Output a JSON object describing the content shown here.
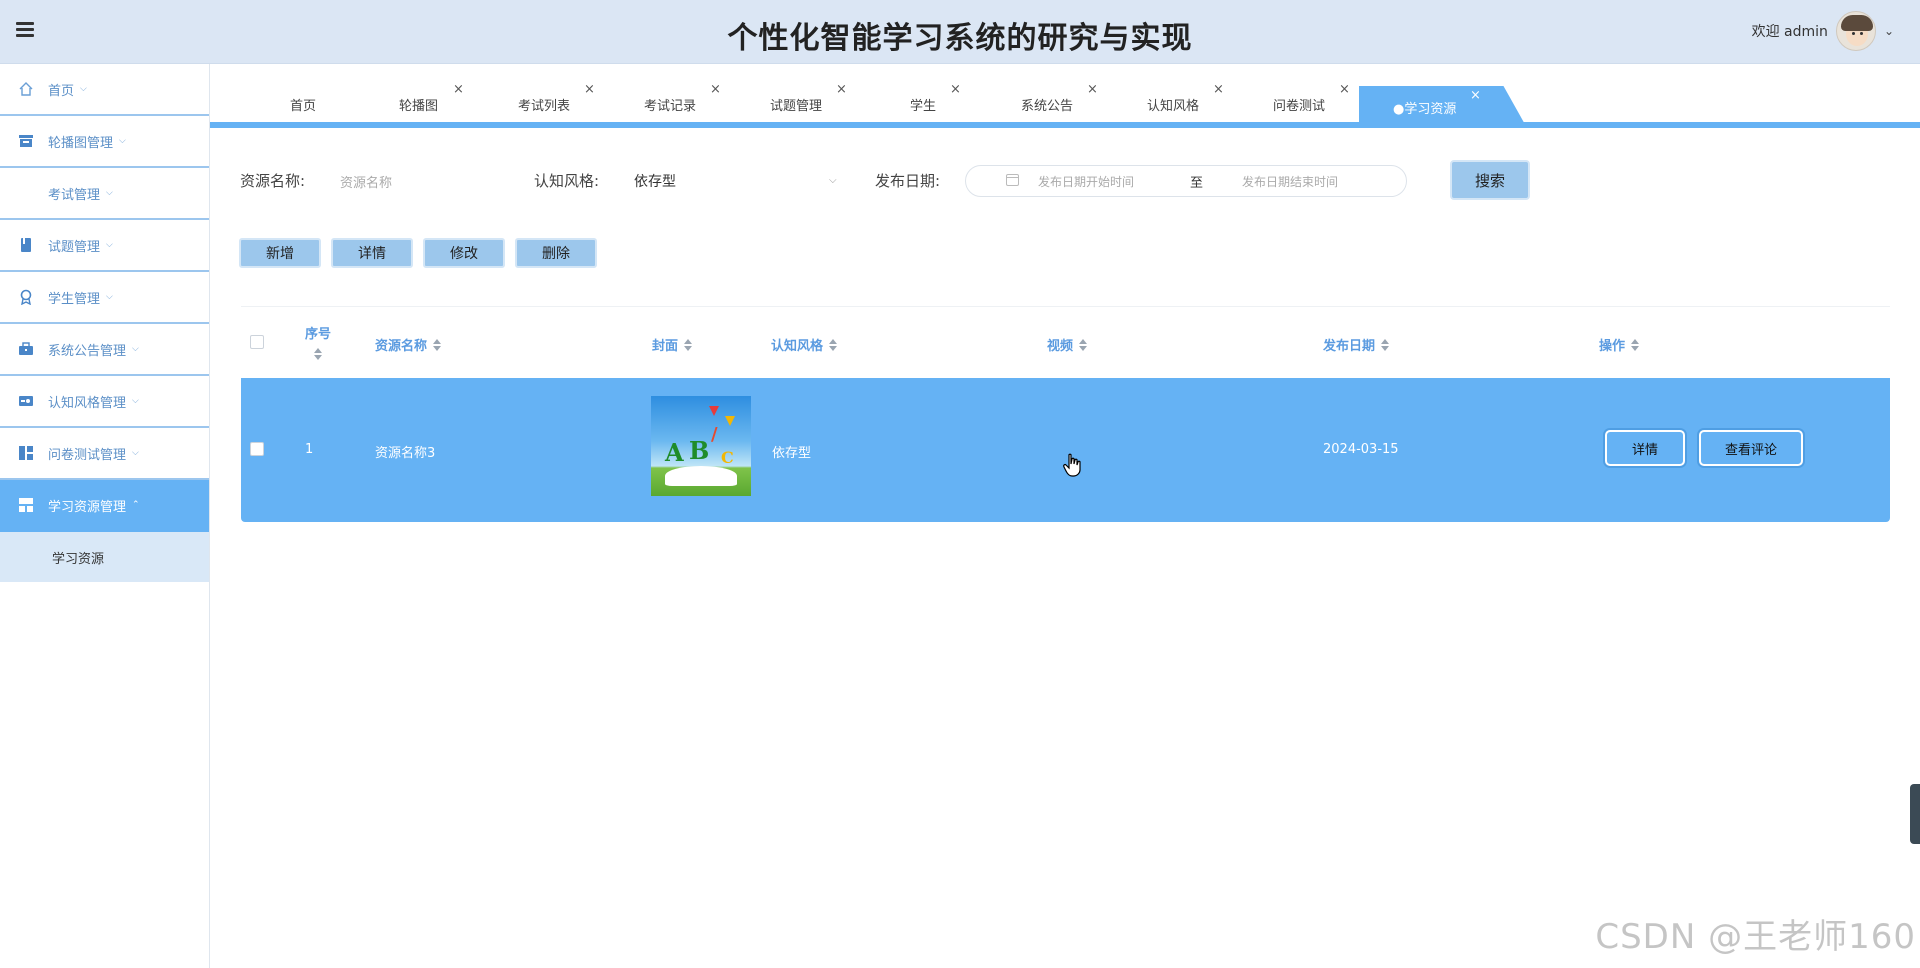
{
  "header": {
    "title": "个性化智能学习系统的研究与实现",
    "welcome": "欢迎 admin"
  },
  "sidebar": {
    "items": [
      {
        "label": "首页",
        "icon": "home-icon"
      },
      {
        "label": "轮播图管理",
        "icon": "carousel-icon"
      },
      {
        "label": "考试管理",
        "icon": ""
      },
      {
        "label": "试题管理",
        "icon": "book-icon"
      },
      {
        "label": "学生管理",
        "icon": "student-icon"
      },
      {
        "label": "系统公告管理",
        "icon": "briefcase-icon"
      },
      {
        "label": "认知风格管理",
        "icon": "style-icon"
      },
      {
        "label": "问卷测试管理",
        "icon": "grid-icon"
      },
      {
        "label": "学习资源管理",
        "icon": "layout-icon"
      }
    ],
    "sub_item": "学习资源"
  },
  "tabs": [
    {
      "label": "首页"
    },
    {
      "label": "轮播图"
    },
    {
      "label": "考试列表"
    },
    {
      "label": "考试记录"
    },
    {
      "label": "试题管理"
    },
    {
      "label": "学生"
    },
    {
      "label": "系统公告"
    },
    {
      "label": "认知风格"
    },
    {
      "label": "问卷测试"
    },
    {
      "label": "●学习资源"
    }
  ],
  "filters": {
    "name_label": "资源名称:",
    "name_placeholder": "资源名称",
    "style_label": "认知风格:",
    "style_value": "依存型",
    "date_label": "发布日期:",
    "date_start_placeholder": "发布日期开始时间",
    "date_sep": "至",
    "date_end_placeholder": "发布日期结束时间",
    "search_button": "搜索"
  },
  "actions": {
    "add": "新增",
    "detail": "详情",
    "edit": "修改",
    "delete": "删除"
  },
  "table": {
    "headers": {
      "index": "序号",
      "name": "资源名称",
      "cover": "封面",
      "style": "认知风格",
      "video": "视频",
      "date": "发布日期",
      "ops": "操作"
    },
    "rows": [
      {
        "index": "1",
        "name": "资源名称3",
        "cover_letters": "A B C",
        "style": "依存型",
        "video": "",
        "date": "2024-03-15",
        "btn_detail": "详情",
        "btn_comments": "查看评论"
      }
    ]
  },
  "watermark": "CSDN @王老师160",
  "colors": {
    "accent": "#65b2f4",
    "header_bg": "#dbe6f4",
    "button_bg": "#9cc7ec"
  }
}
